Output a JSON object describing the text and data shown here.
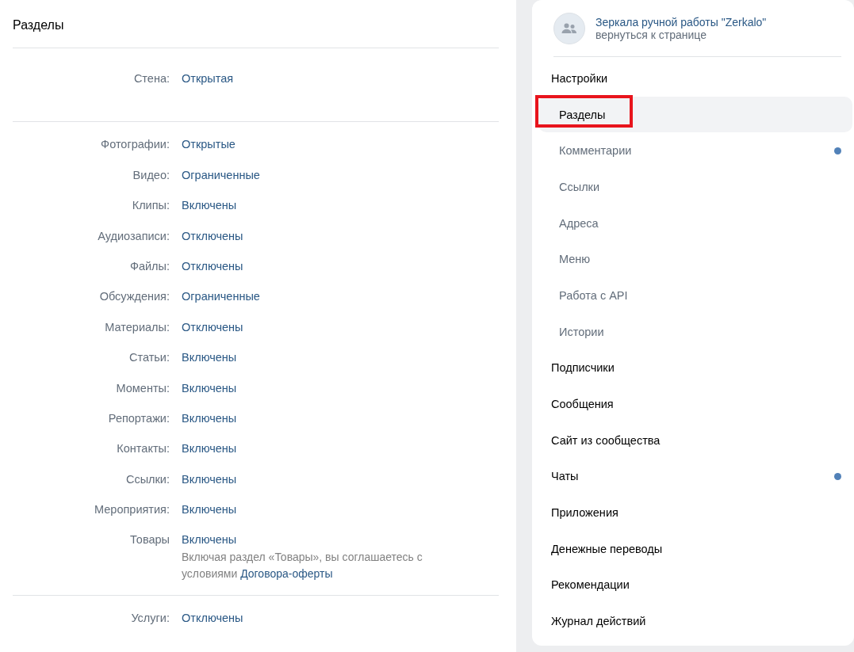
{
  "settings_panel": {
    "title": "Разделы",
    "groups": [
      {
        "rows": [
          {
            "label": "Стена:",
            "value": "Открытая"
          }
        ]
      },
      {
        "rows": [
          {
            "label": "Фотографии:",
            "value": "Открытые"
          },
          {
            "label": "Видео:",
            "value": "Ограниченные"
          },
          {
            "label": "Клипы:",
            "value": "Включены"
          },
          {
            "label": "Аудиозаписи:",
            "value": "Отключены"
          },
          {
            "label": "Файлы:",
            "value": "Отключены"
          },
          {
            "label": "Обсуждения:",
            "value": "Ограниченные"
          },
          {
            "label": "Материалы:",
            "value": "Отключены"
          },
          {
            "label": "Статьи:",
            "value": "Включены"
          },
          {
            "label": "Моменты:",
            "value": "Включены"
          },
          {
            "label": "Репортажи:",
            "value": "Включены"
          },
          {
            "label": "Контакты:",
            "value": "Включены"
          },
          {
            "label": "Ссылки:",
            "value": "Включены"
          },
          {
            "label": "Мероприятия:",
            "value": "Включены"
          },
          {
            "label": "Товары",
            "value": "Включены",
            "note": "Включая раздел «Товары», вы соглашаетесь с условиями",
            "note_link": "Договора-оферты"
          }
        ]
      },
      {
        "rows": [
          {
            "label": "Услуги:",
            "value": "Отключены"
          }
        ]
      }
    ]
  },
  "sidebar": {
    "community_name": "Зеркала ручной работы \"Zerkalo\"",
    "back_link": "вернуться к странице",
    "items": [
      {
        "label": "Настройки",
        "selected": false,
        "dot": false,
        "children": [
          {
            "label": "Разделы",
            "selected": true,
            "highlighted": true,
            "dot": false
          },
          {
            "label": "Комментарии",
            "selected": false,
            "highlighted": false,
            "dot": true
          },
          {
            "label": "Ссылки",
            "selected": false,
            "highlighted": false,
            "dot": false
          },
          {
            "label": "Адреса",
            "selected": false,
            "highlighted": false,
            "dot": false
          },
          {
            "label": "Меню",
            "selected": false,
            "highlighted": false,
            "dot": false
          },
          {
            "label": "Работа с API",
            "selected": false,
            "highlighted": false,
            "dot": false
          },
          {
            "label": "Истории",
            "selected": false,
            "highlighted": false,
            "dot": false
          }
        ]
      },
      {
        "label": "Подписчики",
        "selected": false,
        "dot": false
      },
      {
        "label": "Сообщения",
        "selected": false,
        "dot": false
      },
      {
        "label": "Сайт из сообщества",
        "selected": false,
        "dot": false
      },
      {
        "label": "Чаты",
        "selected": false,
        "dot": true
      },
      {
        "label": "Приложения",
        "selected": false,
        "dot": false
      },
      {
        "label": "Денежные переводы",
        "selected": false,
        "dot": false
      },
      {
        "label": "Рекомендации",
        "selected": false,
        "dot": false
      },
      {
        "label": "Журнал действий",
        "selected": false,
        "dot": false
      }
    ]
  }
}
